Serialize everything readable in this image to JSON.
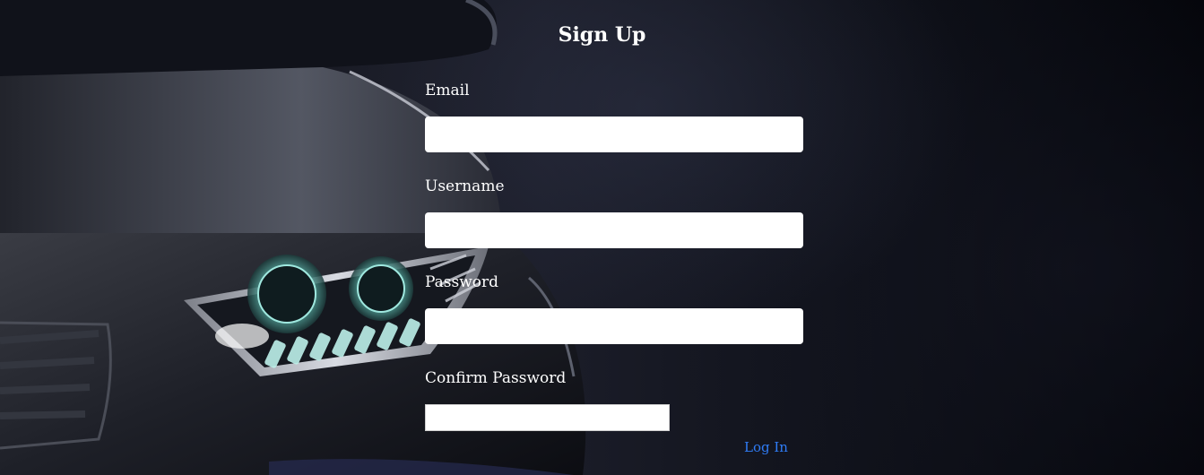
{
  "form": {
    "title": "Sign Up",
    "fields": [
      {
        "label": "Email",
        "value": "",
        "placeholder": ""
      },
      {
        "label": "Username",
        "value": "",
        "placeholder": ""
      },
      {
        "label": "Password",
        "value": "",
        "placeholder": ""
      },
      {
        "label": "Confirm Password",
        "value": "",
        "placeholder": ""
      }
    ],
    "login_link": "Log In"
  },
  "colors": {
    "background": "#07080d",
    "text": "#ffffff",
    "link": "#2f7cf6",
    "input_background": "#ffffff"
  }
}
